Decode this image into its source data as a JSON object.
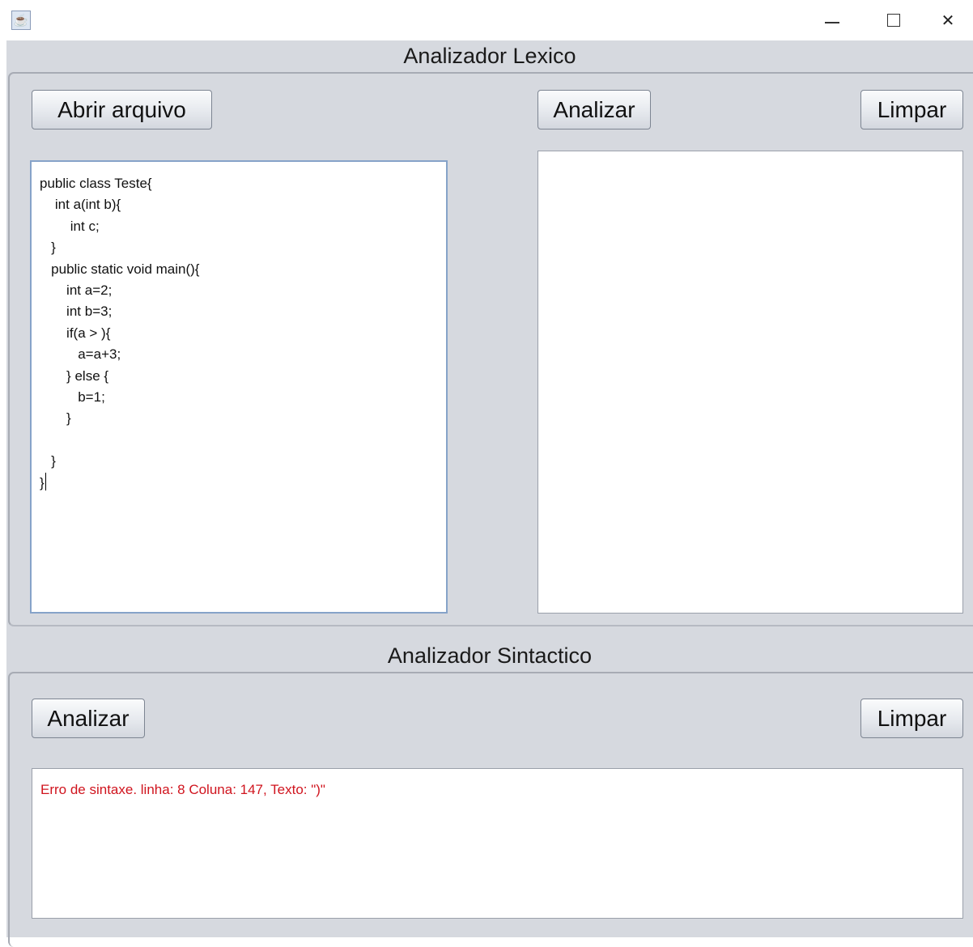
{
  "window": {
    "title": "",
    "app_icon": "java-coffee-cup-icon",
    "controls": [
      "minimize-icon",
      "maximize-icon",
      "close-icon"
    ]
  },
  "lexico": {
    "title": "Analizador Lexico",
    "open_button": "Abrir arquivo",
    "analyze_button": "Analizar",
    "clear_button": "Limpar",
    "source_code": "public class Teste{\n    int a(int b){\n        int c;\n   }\n   public static void main(){\n       int a=2;\n       int b=3;\n       if(a > ){\n          a=a+3;\n       } else {\n          b=1;\n       }\n\n   }\n}",
    "output": ""
  },
  "sintactico": {
    "title": "Analizador Sintactico",
    "analyze_button": "Analizar",
    "clear_button": "Limpar",
    "output": "Erro de sintaxe. linha: 8 Coluna: 147, Texto: \")\"",
    "output_color": "#d0141e"
  }
}
